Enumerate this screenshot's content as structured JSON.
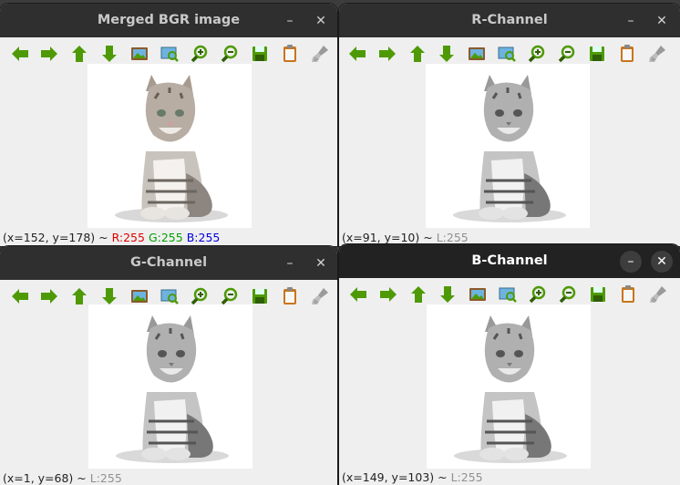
{
  "windows": [
    {
      "title": "Merged BGR image",
      "minimize": "–",
      "close": "✕",
      "status": {
        "coords": "(x=152, y=178) ~ ",
        "r": "R:255",
        "g": "G:255",
        "b": "B:255"
      },
      "color_mode": "color"
    },
    {
      "title": "R-Channel",
      "minimize": "–",
      "close": "✕",
      "status": {
        "coords": "(x=91, y=10) ~ ",
        "lum": "L:255"
      },
      "color_mode": "gray"
    },
    {
      "title": "G-Channel",
      "minimize": "–",
      "close": "✕",
      "status": {
        "coords": "(x=1, y=68) ~ ",
        "lum": "L:255"
      },
      "color_mode": "gray"
    },
    {
      "title": "B-Channel",
      "minimize": "–",
      "close": "✕",
      "status": {
        "coords": "(x=149, y=103) ~ ",
        "lum": "L:255"
      },
      "color_mode": "gray",
      "active": true
    }
  ],
  "toolbar_icons": [
    "arrow-left-icon",
    "arrow-right-icon",
    "arrow-up-icon",
    "arrow-down-icon",
    "image-icon",
    "zoom-fit-icon",
    "zoom-in-icon",
    "zoom-out-icon",
    "save-icon",
    "clipboard-icon",
    "brush-icon"
  ],
  "colors": {
    "icon_green": "#4e9a06",
    "titlebar": "#2f2f2f",
    "window_bg": "#efefef",
    "status_red": "#e00000",
    "status_green": "#00a000",
    "status_blue": "#0000e0"
  }
}
